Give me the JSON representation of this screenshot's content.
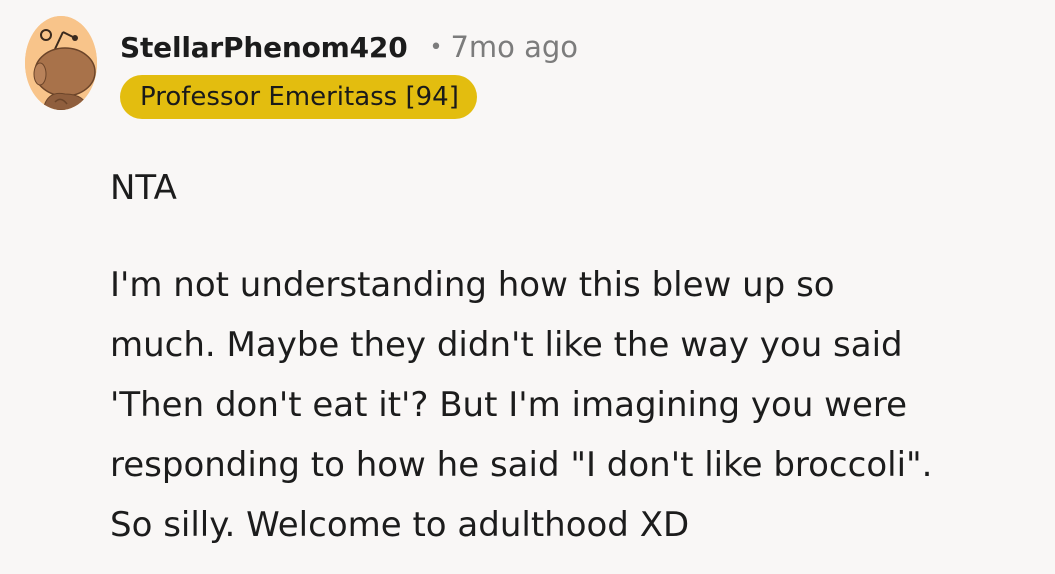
{
  "comment": {
    "avatar_icon": "snoo-avatar-icon",
    "avatar_color": "#f8c48a",
    "username": "StellarPhenom420",
    "separator": "•",
    "time_ago": "7mo ago",
    "flair": {
      "text": "Professor Emeritass [94]",
      "background": "#e3bd0f"
    },
    "body": {
      "verdict": "NTA",
      "lines": [
        "I'm not understanding how this blew up so",
        "much. Maybe they didn't like the way you said",
        "'Then don't eat it'? But I'm imagining you were",
        "responding to how he said \"I don't like broccoli\".",
        "So silly. Welcome to adulthood XD"
      ]
    }
  }
}
